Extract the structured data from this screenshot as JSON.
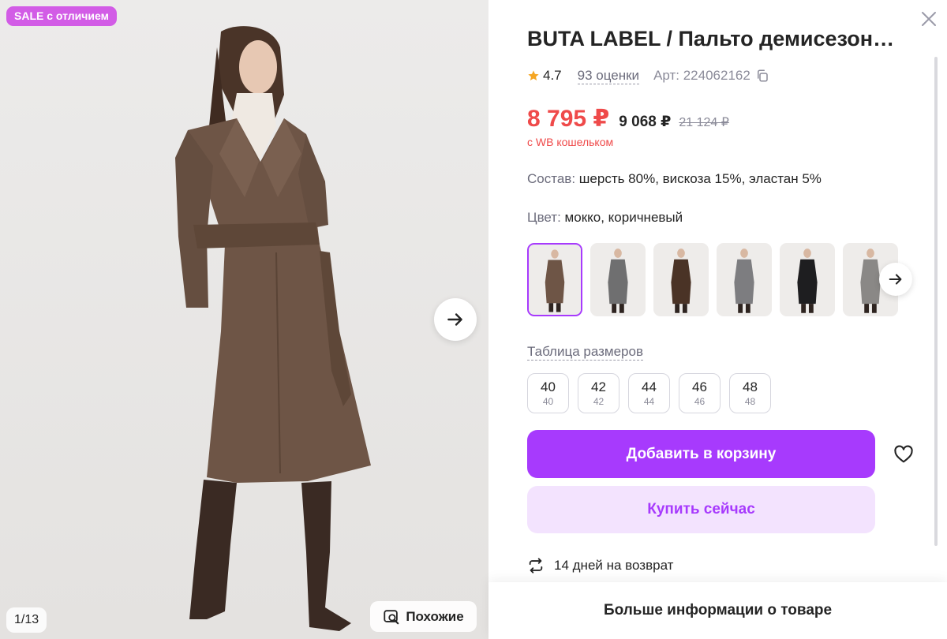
{
  "gallery": {
    "badge": "SALE с отличием",
    "counter": "1/13",
    "similar_label": "Похожие",
    "icons": {
      "next": "arrow-right-icon",
      "similar": "image-search-icon"
    }
  },
  "product": {
    "title": "BUTA LABEL / Пальто демисезонное",
    "rating": "4.7",
    "reviews": "93 оценки",
    "article": "Арт: 224062162",
    "price_wallet": "8 795 ₽",
    "price_regular": "9 068 ₽",
    "price_old": "21 124 ₽",
    "wallet_note": "с WB кошельком",
    "composition_key": "Состав:",
    "composition_value": " шерсть 80%, вискоза 15%, эластан 5%",
    "color_key": "Цвет:",
    "color_value": " мокко, коричневый",
    "swatches": [
      {
        "name": "brown",
        "coat": "#6e5546",
        "selected": true
      },
      {
        "name": "grey-1",
        "coat": "#6f6f70",
        "selected": false
      },
      {
        "name": "brown-2",
        "coat": "#4a3326",
        "selected": false
      },
      {
        "name": "grey-2",
        "coat": "#7d7d80",
        "selected": false
      },
      {
        "name": "black",
        "coat": "#1e1e20",
        "selected": false
      },
      {
        "name": "grey-3",
        "coat": "#8a8886",
        "selected": false
      }
    ],
    "size_table": "Таблица размеров",
    "sizes": [
      {
        "main": "40",
        "sub": "40"
      },
      {
        "main": "42",
        "sub": "42"
      },
      {
        "main": "44",
        "sub": "44"
      },
      {
        "main": "46",
        "sub": "46"
      },
      {
        "main": "48",
        "sub": "48"
      }
    ],
    "add_to_cart": "Добавить в корзину",
    "buy_now": "Купить сейчас",
    "returns": "14 дней на возврат",
    "more_info": "Больше информации о товаре"
  },
  "colors": {
    "accent": "#a73afd",
    "accent_light": "#f3e3fe",
    "price_red": "#ef4a4a",
    "badge": "#d25ce6"
  }
}
